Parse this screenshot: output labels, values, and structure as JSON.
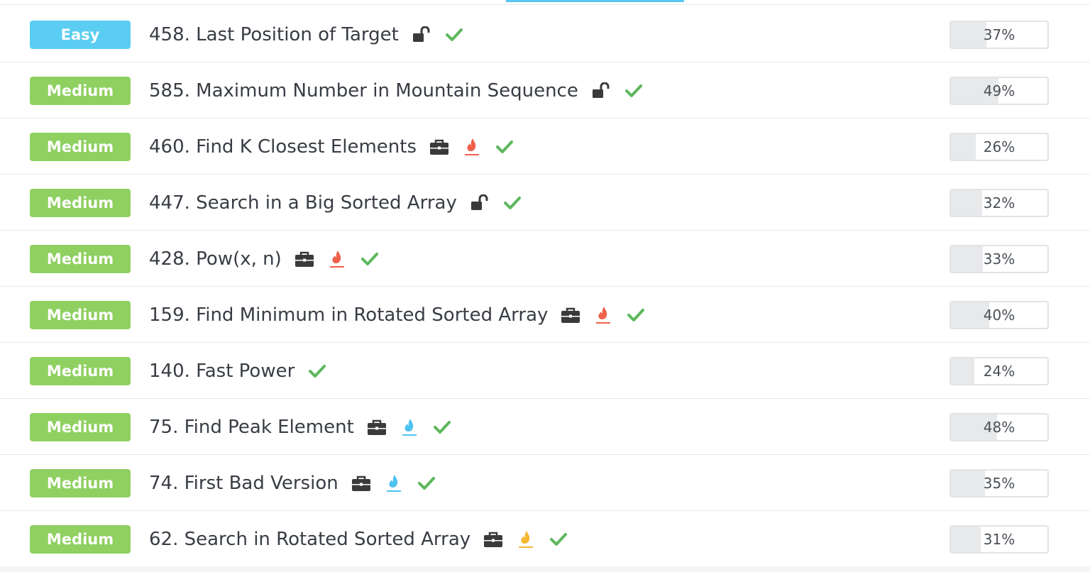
{
  "colors": {
    "easy": "#5bcdf2",
    "medium": "#8fd061",
    "check": "#5cb85c",
    "lock": "#3a3a3a",
    "briefcase": "#3a3a3a",
    "hot_red": "#f0604a",
    "hot_blue": "#4fc3f0",
    "hot_yellow": "#f5b932"
  },
  "problems": [
    {
      "difficulty": "Easy",
      "title": "458. Last Position of Target",
      "icons": [
        "lock-icon",
        "check-icon"
      ],
      "rate": 0.37,
      "rate_label": "37%"
    },
    {
      "difficulty": "Medium",
      "title": "585. Maximum Number in Mountain Sequence",
      "icons": [
        "lock-icon",
        "check-icon"
      ],
      "rate": 0.49,
      "rate_label": "49%"
    },
    {
      "difficulty": "Medium",
      "title": "460. Find K Closest Elements",
      "icons": [
        "briefcase-icon",
        "flame-red-icon",
        "check-icon"
      ],
      "rate": 0.26,
      "rate_label": "26%"
    },
    {
      "difficulty": "Medium",
      "title": "447. Search in a Big Sorted Array",
      "icons": [
        "lock-icon",
        "check-icon"
      ],
      "rate": 0.32,
      "rate_label": "32%"
    },
    {
      "difficulty": "Medium",
      "title": "428. Pow(x, n)",
      "icons": [
        "briefcase-icon",
        "flame-red-icon",
        "check-icon"
      ],
      "rate": 0.33,
      "rate_label": "33%"
    },
    {
      "difficulty": "Medium",
      "title": "159. Find Minimum in Rotated Sorted Array",
      "icons": [
        "briefcase-icon",
        "flame-red-icon",
        "check-icon"
      ],
      "rate": 0.4,
      "rate_label": "40%"
    },
    {
      "difficulty": "Medium",
      "title": "140. Fast Power",
      "icons": [
        "check-icon"
      ],
      "rate": 0.24,
      "rate_label": "24%"
    },
    {
      "difficulty": "Medium",
      "title": "75. Find Peak Element",
      "icons": [
        "briefcase-icon",
        "flame-blue-icon",
        "check-icon"
      ],
      "rate": 0.48,
      "rate_label": "48%"
    },
    {
      "difficulty": "Medium",
      "title": "74. First Bad Version",
      "icons": [
        "briefcase-icon",
        "flame-blue-icon",
        "check-icon"
      ],
      "rate": 0.35,
      "rate_label": "35%"
    },
    {
      "difficulty": "Medium",
      "title": "62. Search in Rotated Sorted Array",
      "icons": [
        "briefcase-icon",
        "flame-yellow-icon",
        "check-icon"
      ],
      "rate": 0.31,
      "rate_label": "31%"
    }
  ]
}
